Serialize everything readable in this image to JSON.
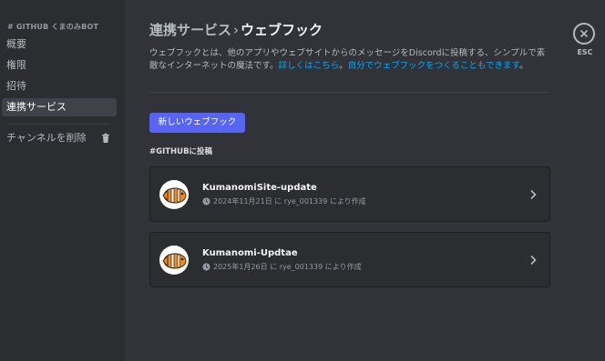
{
  "sidebar": {
    "header": "# GITHUB くまのみBOT",
    "items": [
      {
        "label": "概要"
      },
      {
        "label": "権限"
      },
      {
        "label": "招待"
      },
      {
        "label": "連携サービス"
      }
    ],
    "delete_label": "チャンネルを削除"
  },
  "header": {
    "crumb": "連携サービス",
    "separator": "›",
    "title": "ウェブフック"
  },
  "description": {
    "text": "ウェブフックとは、他のアプリやウェブサイトからのメッセージをDiscordに投稿する、シンプルで素敵なインターネットの魔法です。",
    "link1": "詳しくはこちら",
    "mid": "。",
    "link2": "自分でウェブフックをつくることもできます",
    "end": "。"
  },
  "new_button_label": "新しいウェブフック",
  "section_label": "#GITHUBに投稿",
  "webhooks": [
    {
      "name": "KumanomiSite-update",
      "meta": "2024年11月21日 に rye_001339 により作成"
    },
    {
      "name": "Kumanomi-Updtae",
      "meta": "2025年1月26日 に rye_001339 により作成"
    }
  ],
  "close": {
    "label": "ESC"
  },
  "icons": {
    "trash": "trash-icon",
    "clock": "clock-icon",
    "chevron": "chevron-right-icon",
    "close": "close-icon",
    "avatar": "clownfish-avatar"
  },
  "colors": {
    "accent": "#5865f2",
    "link": "#00a8fc",
    "background": "#313338",
    "sidebar": "#2b2d31"
  }
}
